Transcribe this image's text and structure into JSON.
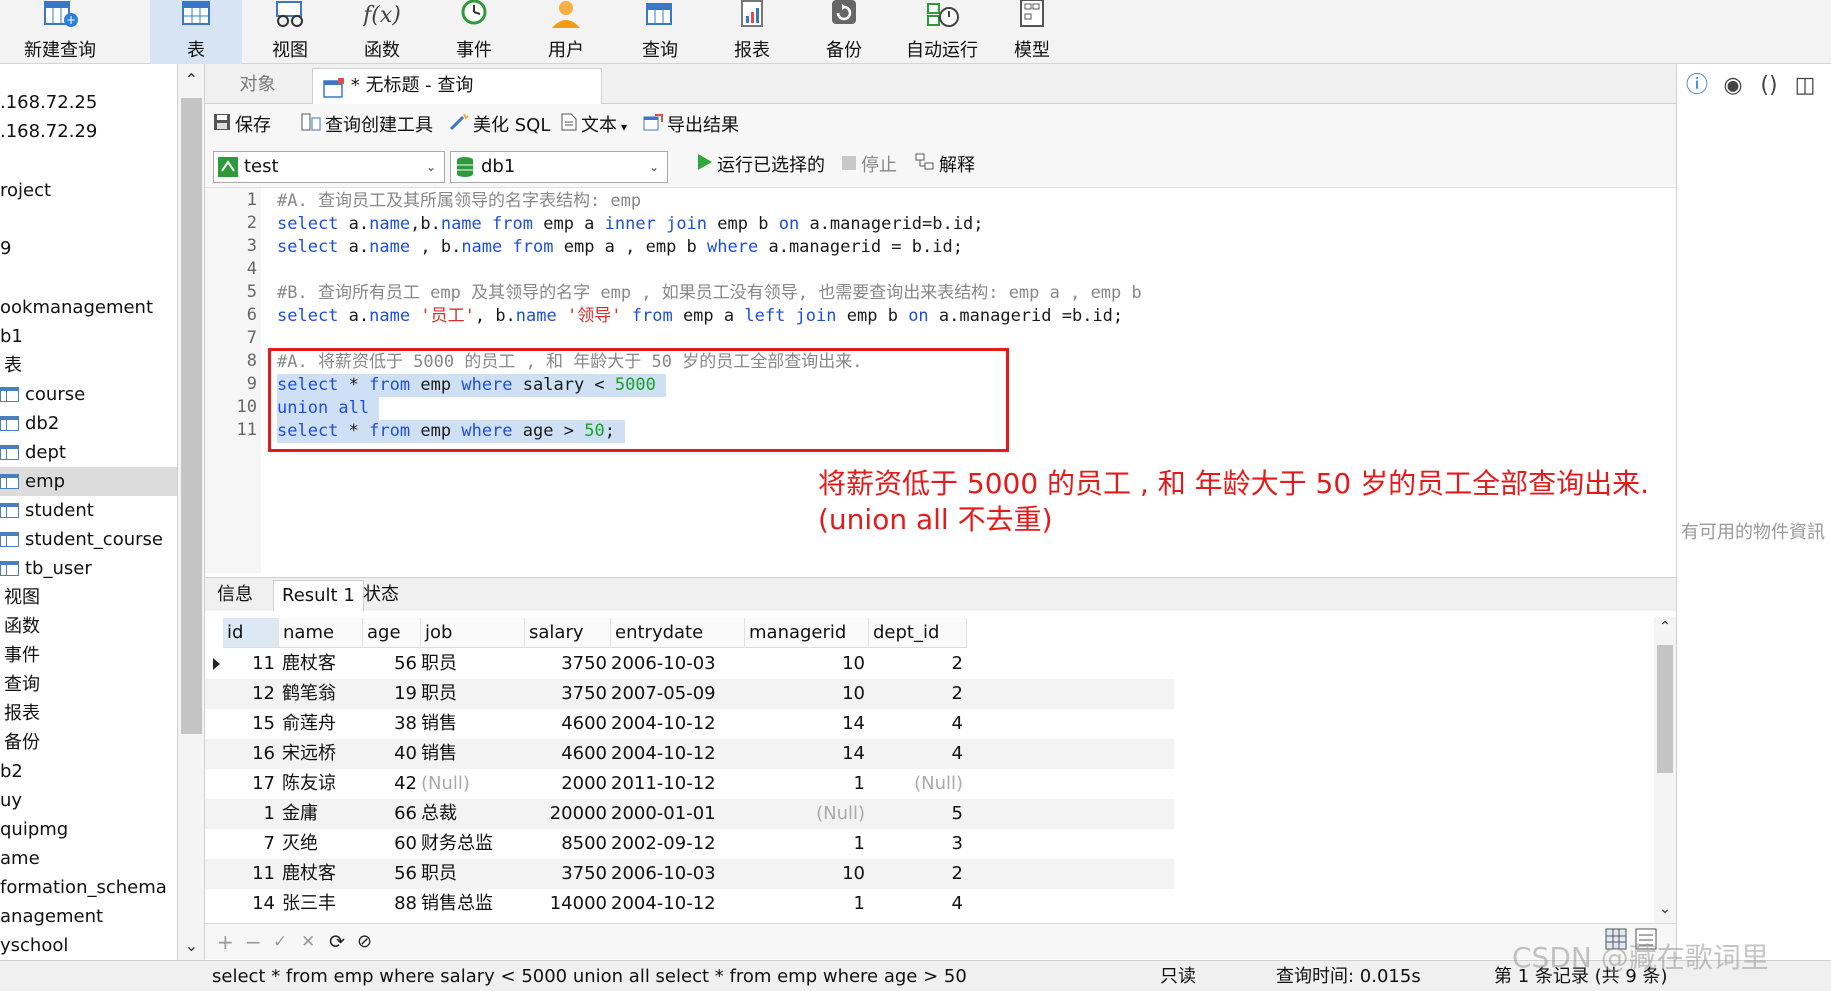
{
  "toolbar": {
    "buttons": [
      {
        "label": "新建查询",
        "icon": "new-query-icon"
      },
      {
        "label": "表",
        "icon": "table-icon"
      },
      {
        "label": "视图",
        "icon": "view-icon"
      },
      {
        "label": "函数",
        "icon": "function-icon"
      },
      {
        "label": "事件",
        "icon": "event-icon"
      },
      {
        "label": "用户",
        "icon": "user-icon"
      },
      {
        "label": "查询",
        "icon": "query-icon"
      },
      {
        "label": "报表",
        "icon": "report-icon"
      },
      {
        "label": "备份",
        "icon": "backup-icon"
      },
      {
        "label": "自动运行",
        "icon": "auto-run-icon"
      },
      {
        "label": "模型",
        "icon": "model-icon"
      }
    ],
    "active": "表"
  },
  "nav": {
    "items": [
      ".168.72.25",
      ".168.72.29",
      "roject",
      "9",
      "ookmanagement",
      "b1",
      "表",
      "course",
      "db2",
      "dept",
      "emp",
      "student",
      "student_course",
      "tb_user",
      "视图",
      "函数",
      "事件",
      "查询",
      "报表",
      "备份",
      "b2",
      "uy",
      "quipmg",
      "ame",
      "formation_schema",
      "anagement",
      "yschool"
    ],
    "selected": "emp"
  },
  "tabs": {
    "objects": "对象",
    "query": "* 无标题 - 查询"
  },
  "editor_toolbar": {
    "save": "保存",
    "builder": "查询创建工具",
    "beautify": "美化 SQL",
    "text": "文本",
    "export": "导出结果"
  },
  "db_bar": {
    "connection": "test",
    "database": "db1",
    "run_selected": "运行已选择的",
    "stop": "停止",
    "explain": "解释"
  },
  "code_lines": [
    "#A. 查询员工及其所属领导的名字表结构: emp",
    "select a.name,b.name from emp a inner join emp b on a.managerid=b.id;",
    "select a.name , b.name from emp a , emp b where a.managerid = b.id;",
    "",
    "#B. 查询所有员工 emp 及其领导的名字 emp , 如果员工没有领导, 也需要查询出来表结构: emp a , emp b",
    "select a.name '员工', b.name '领导' from emp a left join emp b on a.managerid =b.id;",
    "",
    "#A. 将薪资低于 5000 的员工 , 和 年龄大于 50 岁的员工全部查询出来.",
    "select * from emp where salary < 5000",
    "union all",
    "select * from emp where age > 50;"
  ],
  "annotation": {
    "line1": "将薪资低于 5000 的员工 , 和 年龄大于 50 岁的员工全部查询出来.",
    "line2": "(union all 不去重)"
  },
  "right_pane": {
    "message": "有可用的物件資訊"
  },
  "result_tabs": [
    "信息",
    "Result 1",
    "状态"
  ],
  "result": {
    "columns": [
      "id",
      "name",
      "age",
      "job",
      "salary",
      "entrydate",
      "managerid",
      "dept_id"
    ],
    "rows": [
      [
        "11",
        "鹿杖客",
        "56",
        "职员",
        "3750",
        "2006-10-03",
        "10",
        "2"
      ],
      [
        "12",
        "鹤笔翁",
        "19",
        "职员",
        "3750",
        "2007-05-09",
        "10",
        "2"
      ],
      [
        "15",
        "俞莲舟",
        "38",
        "销售",
        "4600",
        "2004-10-12",
        "14",
        "4"
      ],
      [
        "16",
        "宋远桥",
        "40",
        "销售",
        "4600",
        "2004-10-12",
        "14",
        "4"
      ],
      [
        "17",
        "陈友谅",
        "42",
        "(Null)",
        "2000",
        "2011-10-12",
        "1",
        "(Null)"
      ],
      [
        "1",
        "金庸",
        "66",
        "总裁",
        "20000",
        "2000-01-01",
        "(Null)",
        "5"
      ],
      [
        "7",
        "灭绝",
        "60",
        "财务总监",
        "8500",
        "2002-09-12",
        "1",
        "3"
      ],
      [
        "11",
        "鹿杖客",
        "56",
        "职员",
        "3750",
        "2006-10-03",
        "10",
        "2"
      ],
      [
        "14",
        "张三丰",
        "88",
        "销售总监",
        "14000",
        "2004-10-12",
        "1",
        "4"
      ]
    ]
  },
  "status": {
    "sql": "select * from emp where salary < 5000 union all select * from emp where age > 50",
    "readonly": "只读",
    "time": "查询时间: 0.015s",
    "records": "第 1 条记录 (共 9 条)"
  },
  "watermark": "CSDN @藏在歌词里",
  "colors": {
    "keyword": "#1e4fd6",
    "string": "#d4302a",
    "number": "#17a327",
    "comment": "#888888",
    "annotation": "#e31b1b",
    "selection": "#cfe0f5"
  }
}
